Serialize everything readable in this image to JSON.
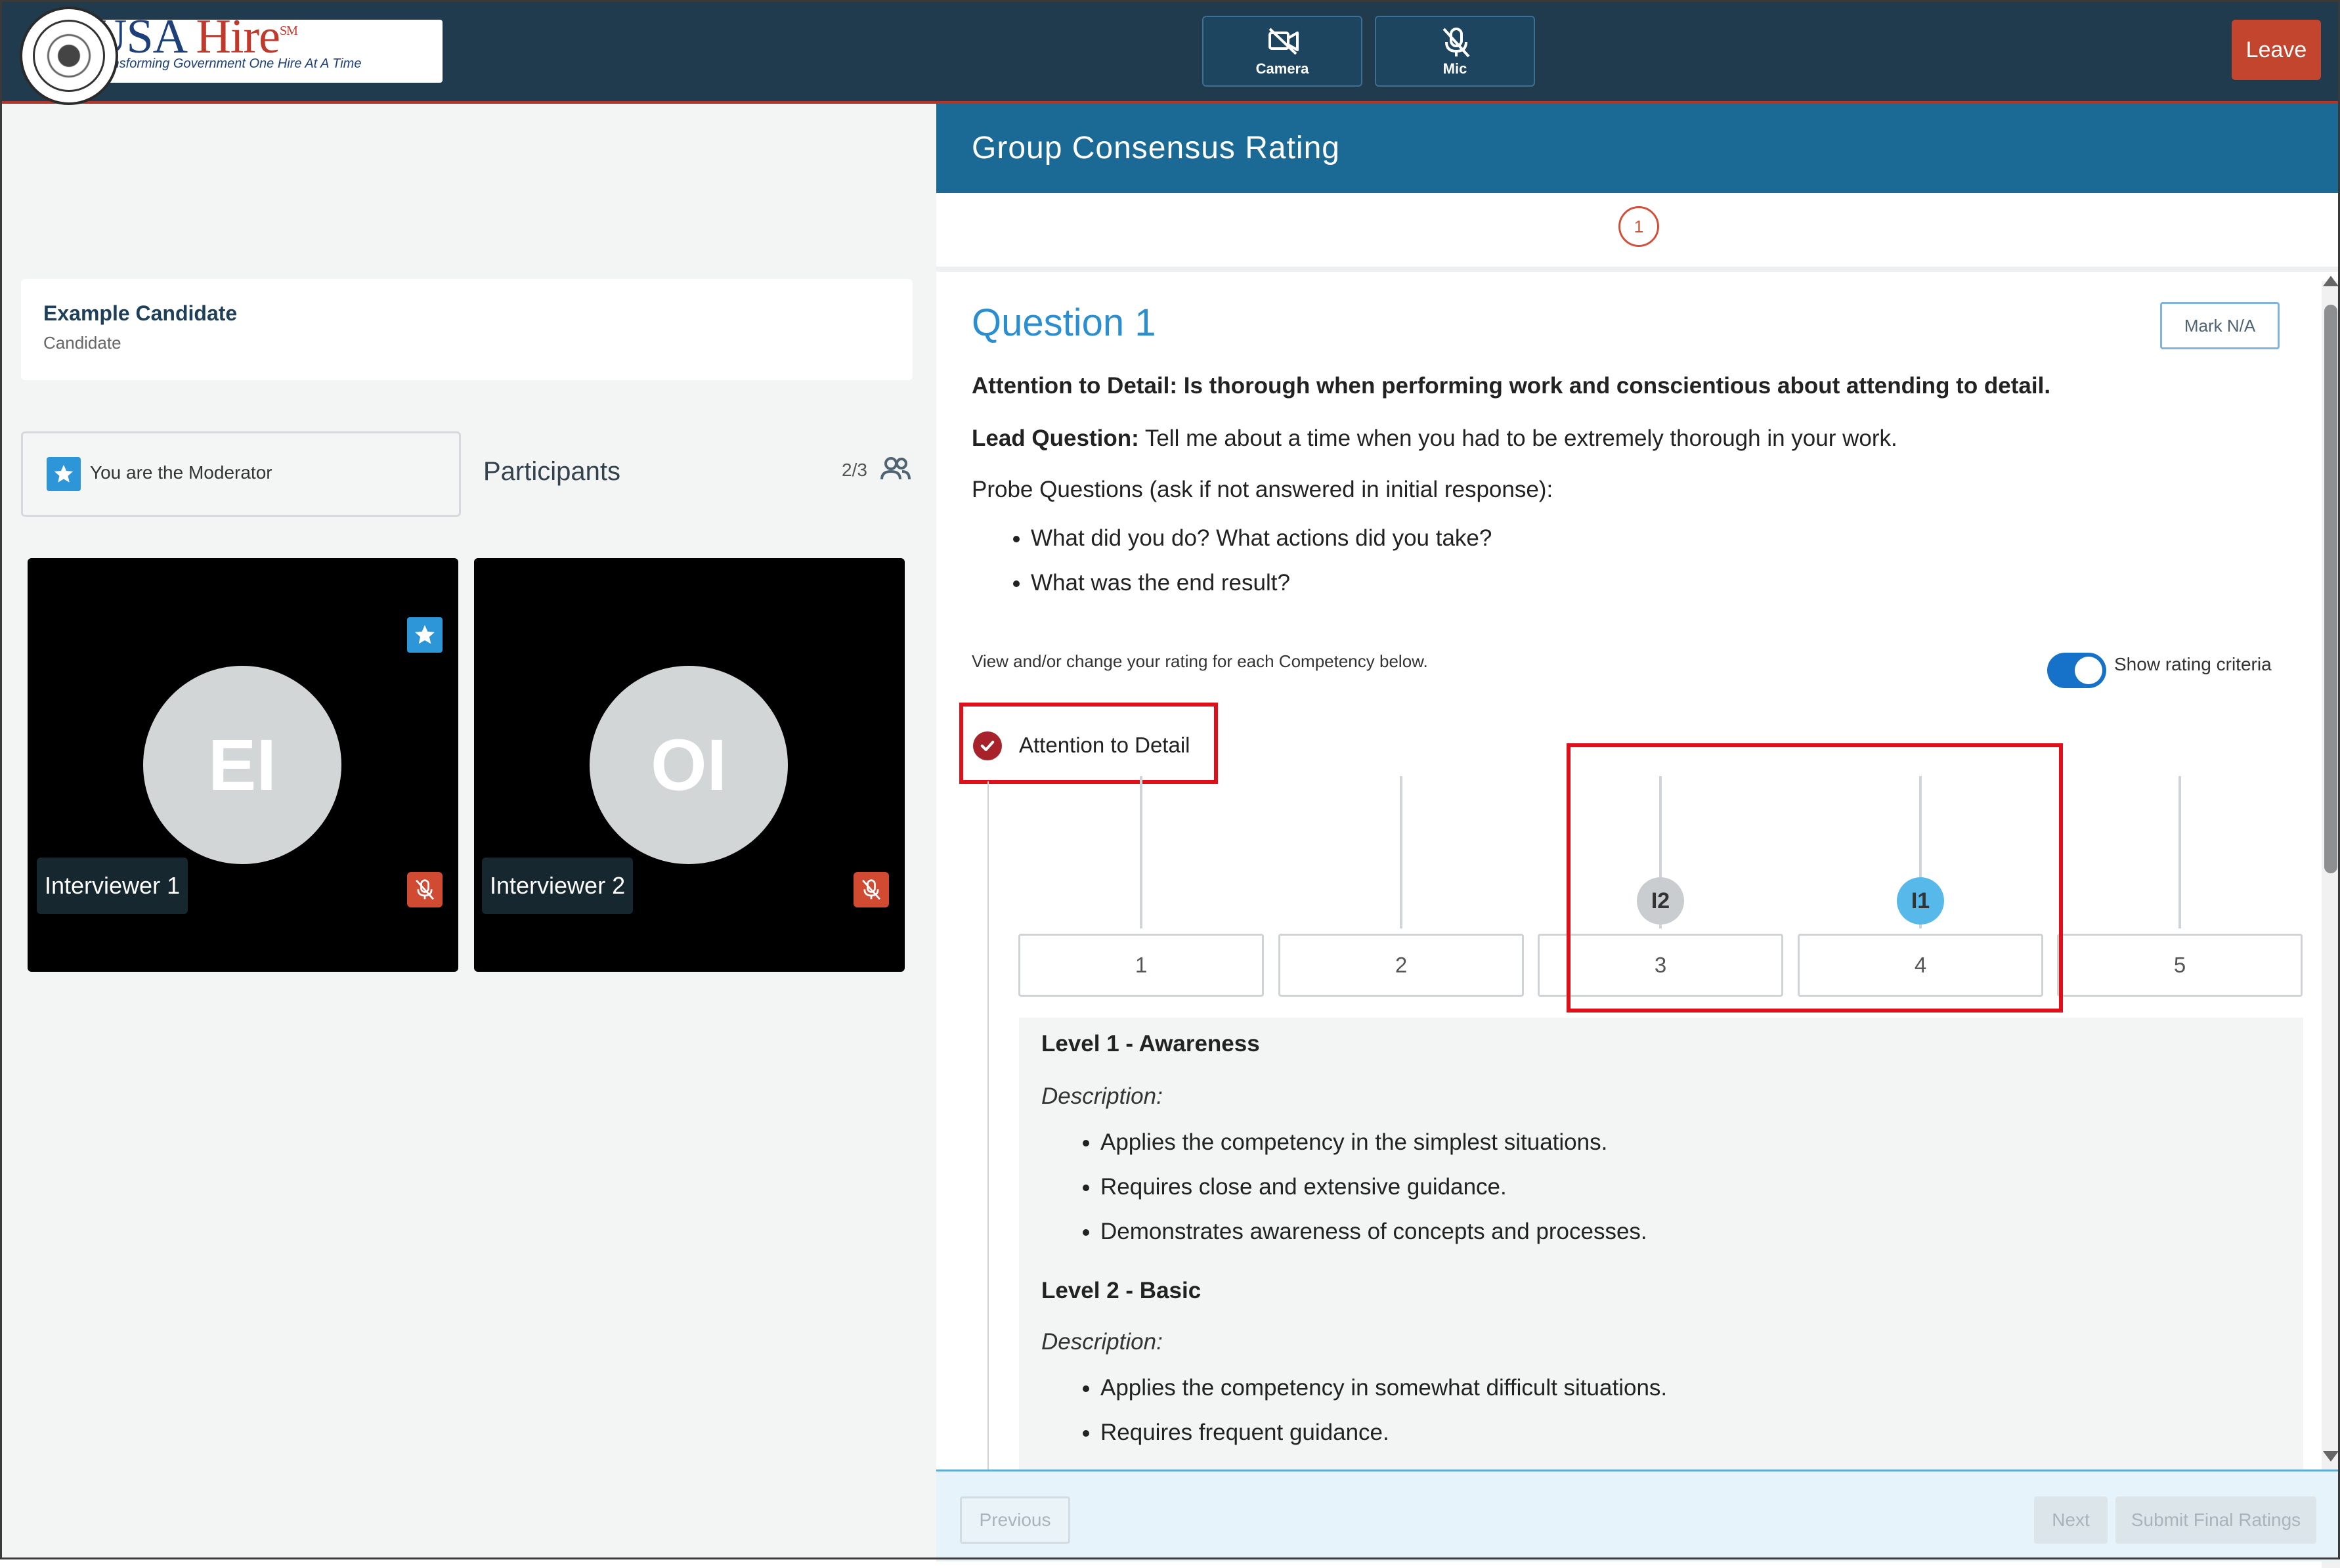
{
  "topbar": {
    "logo_name": "USA Hire",
    "logo_usa": "USA ",
    "logo_hire": "Hire",
    "logo_mark": "SM",
    "logo_tagline": "Transforming Government One Hire At A Time",
    "camera_label": "Camera",
    "mic_label": "Mic",
    "leave_label": "Leave",
    "colors": {
      "bar": "#1f3b4d",
      "leave": "#c4452d",
      "accent_line": "#b63327"
    }
  },
  "candidate": {
    "name": "Example Candidate",
    "role": "Candidate"
  },
  "moderator_text": "You are the Moderator",
  "participants": {
    "title": "Participants",
    "count": "2/3",
    "tiles": [
      {
        "initials": "EI",
        "name": "Interviewer 1",
        "is_moderator": true,
        "muted": true
      },
      {
        "initials": "OI",
        "name": "Interviewer 2",
        "is_moderator": false,
        "muted": true
      }
    ]
  },
  "rating": {
    "header": "Group Consensus Rating",
    "step": "1",
    "question_title": "Question 1",
    "mark_na": "Mark N/A",
    "competency_label": "Attention to Detail:",
    "competency_text": " Is thorough when performing work and conscientious about attending to detail.",
    "lead_label": "Lead Question:",
    "lead_text": " Tell me about a time when you had to be extremely thorough in your work.",
    "probe_label": "Probe Questions",
    "probe_text": " (ask if not answered in initial response):",
    "probes": [
      "What did you do? What actions did you take?",
      "What was the end result?"
    ],
    "view_note": "View and/or change your rating for each Competency below.",
    "toggle_label": "Show rating criteria",
    "toggle_on": true,
    "competency_name": "Attention to Detail",
    "scale": [
      "1",
      "2",
      "3",
      "4",
      "5"
    ],
    "markers": [
      {
        "label": "I2",
        "rating": 3,
        "color": "#c9cdcf"
      },
      {
        "label": "I1",
        "rating": 4,
        "color": "#56b9ea"
      }
    ],
    "criteria": [
      {
        "title": "Level 1 - Awareness",
        "desc_label": "Description:",
        "items": [
          "Applies the competency in the simplest situations.",
          "Requires close and extensive guidance.",
          "Demonstrates awareness of concepts and processes."
        ]
      },
      {
        "title": "Level 2 - Basic",
        "desc_label": "Description:",
        "items": [
          "Applies the competency in somewhat difficult situations.",
          "Requires frequent guidance."
        ]
      }
    ],
    "footer": {
      "previous": "Previous",
      "next": "Next",
      "submit": "Submit Final Ratings"
    }
  }
}
